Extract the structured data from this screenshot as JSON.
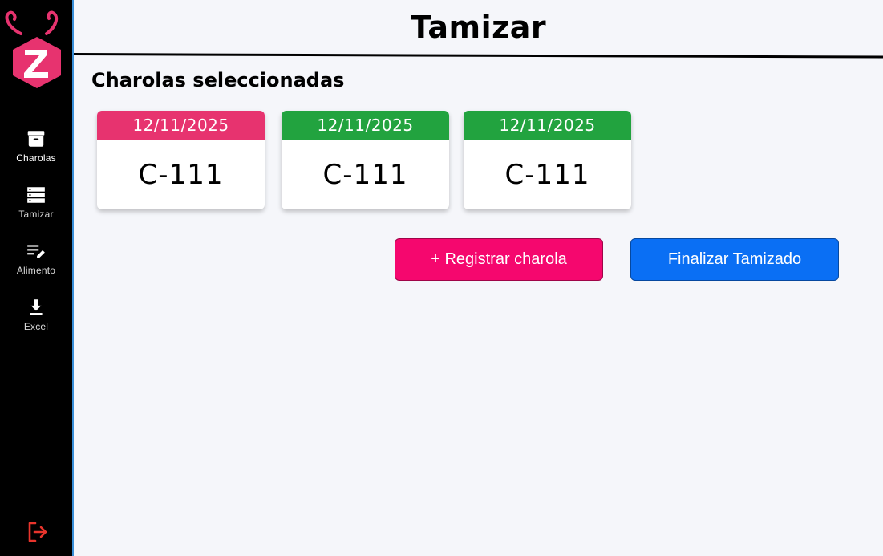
{
  "app": {
    "title": "Tamizar"
  },
  "colors": {
    "sidebar_bg": "#000000",
    "accent_pink": "#e7336f",
    "green": "#22a33f",
    "register_button": "#f5076e",
    "finish_button": "#0a6ff4",
    "logout_red": "#e8342c"
  },
  "sidebar": {
    "logo_icon": "zeta-bug-logo",
    "items": [
      {
        "label": "Charolas",
        "icon": "archive-box-icon",
        "active": true
      },
      {
        "label": "Tamizar",
        "icon": "server-stack-icon",
        "active": false
      },
      {
        "label": "Alimento",
        "icon": "list-edit-icon",
        "active": false
      },
      {
        "label": "Excel",
        "icon": "download-icon",
        "active": false
      }
    ],
    "logout_icon": "logout-icon"
  },
  "main": {
    "section_title": "Charolas seleccionadas",
    "trays": [
      {
        "date": "12/11/2025",
        "code": "C-111",
        "header_color": "#e7336f"
      },
      {
        "date": "12/11/2025",
        "code": "C-111",
        "header_color": "#22a33f"
      },
      {
        "date": "12/11/2025",
        "code": "C-111",
        "header_color": "#22a33f"
      }
    ],
    "buttons": {
      "register_label": "+ Registrar charola",
      "finish_label": "Finalizar Tamizado"
    }
  }
}
